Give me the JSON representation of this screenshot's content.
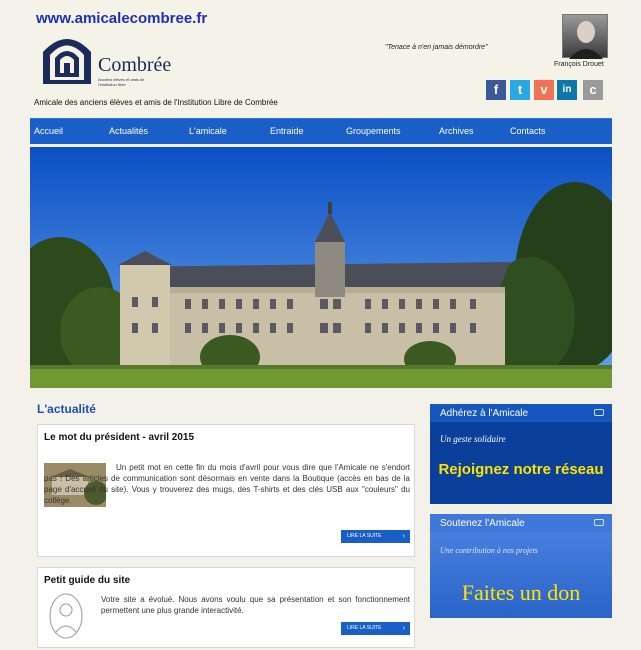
{
  "header": {
    "site_url": "www.amicalecombree.fr",
    "logo_name": "Combrée",
    "logo_subtitle": "Anciens élèves et amis de l'Institution libre",
    "tagline": "Amicale des anciens élèves et amis de l'Institution Libre de Combrée",
    "quote": "\"Tenace à n'en jamais démordre\"",
    "portrait_name": "François Drouet",
    "social": [
      {
        "icon": "facebook-icon",
        "glyph": "f",
        "color": "#3b5998"
      },
      {
        "icon": "twitter-icon",
        "glyph": "t",
        "color": "#29a9e1"
      },
      {
        "icon": "viadeo-icon",
        "glyph": "v",
        "color": "#f07355"
      },
      {
        "icon": "linkedin-icon",
        "glyph": "in",
        "color": "#0e76a8"
      },
      {
        "icon": "copainsdavant-icon",
        "glyph": "c",
        "color": "#9a9a9a"
      }
    ]
  },
  "nav": {
    "items": [
      "Accueil",
      "Actualités",
      "L'amicale",
      "Entraide",
      "Groupements",
      "Archives",
      "Contacts"
    ],
    "color": "#1a5fc8"
  },
  "main": {
    "section_title": "L'actualité",
    "articles": [
      {
        "title": "Le mot du président - avril 2015",
        "text": "Un petit mot en cette fin du mois d'avril pour vous dire que l'Amicale ne s'endort pas ! Des articles de communication sont désormais en vente dans la Boutique (accès en bas de la page d'accueil du site). Vous y trouverez des mugs, des T-shirts et des clés USB aux \"couleurs\" du collège.",
        "read_more": "LIRE LA SUITE"
      },
      {
        "title": "Petit guide du site",
        "text": "Votre site a évolué. Nous avons voulu que sa présentation et son fonctionnement permettent une plus grande interactivité.",
        "read_more": "LIRE LA SUITE"
      }
    ]
  },
  "sidebar": {
    "promos": [
      {
        "header": "Adhérez à l'Amicale",
        "subtitle": "Un geste solidaire",
        "cta": "Rejoignez notre réseau"
      },
      {
        "header": "Soutenez l'Amicale",
        "subtitle": "Une contribution à nos projets",
        "cta": "Faites un don"
      }
    ]
  }
}
